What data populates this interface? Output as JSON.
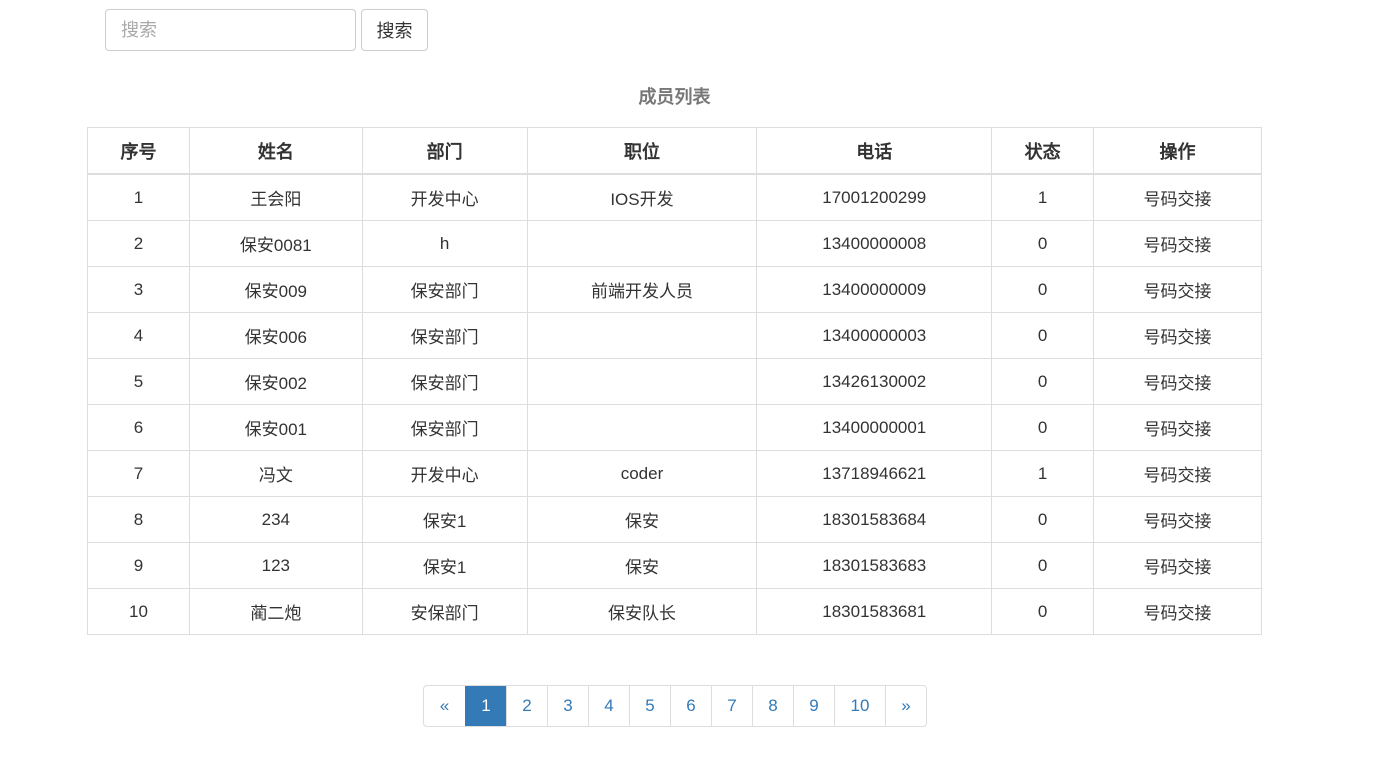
{
  "search": {
    "placeholder": "搜索",
    "value": "",
    "button_label": "搜索"
  },
  "table": {
    "caption": "成员列表",
    "headers": [
      "序号",
      "姓名",
      "部门",
      "职位",
      "电话",
      "状态",
      "操作"
    ],
    "rows": [
      {
        "index": "1",
        "name": "王会阳",
        "dept": "开发中心",
        "position": "IOS开发",
        "phone": "17001200299",
        "status": "1",
        "action": "号码交接"
      },
      {
        "index": "2",
        "name": "保安0081",
        "dept": "h",
        "position": "",
        "phone": "13400000008",
        "status": "0",
        "action": "号码交接"
      },
      {
        "index": "3",
        "name": "保安009",
        "dept": "保安部门",
        "position": "前端开发人员",
        "phone": "13400000009",
        "status": "0",
        "action": "号码交接"
      },
      {
        "index": "4",
        "name": "保安006",
        "dept": "保安部门",
        "position": "",
        "phone": "13400000003",
        "status": "0",
        "action": "号码交接"
      },
      {
        "index": "5",
        "name": "保安002",
        "dept": "保安部门",
        "position": "",
        "phone": "13426130002",
        "status": "0",
        "action": "号码交接"
      },
      {
        "index": "6",
        "name": "保安001",
        "dept": "保安部门",
        "position": "",
        "phone": "13400000001",
        "status": "0",
        "action": "号码交接"
      },
      {
        "index": "7",
        "name": "冯文",
        "dept": "开发中心",
        "position": "coder",
        "phone": "13718946621",
        "status": "1",
        "action": "号码交接"
      },
      {
        "index": "8",
        "name": "234",
        "dept": "保安1",
        "position": "保安",
        "phone": "18301583684",
        "status": "0",
        "action": "号码交接"
      },
      {
        "index": "9",
        "name": "123",
        "dept": "保安1",
        "position": "保安",
        "phone": "18301583683",
        "status": "0",
        "action": "号码交接"
      },
      {
        "index": "10",
        "name": "蔺二炮",
        "dept": "安保部门",
        "position": "保安队长",
        "phone": "18301583681",
        "status": "0",
        "action": "号码交接"
      }
    ]
  },
  "pagination": {
    "prev": "«",
    "next": "»",
    "pages": [
      "1",
      "2",
      "3",
      "4",
      "5",
      "6",
      "7",
      "8",
      "9",
      "10"
    ],
    "current": "1"
  },
  "colors": {
    "accent": "#337ab7",
    "border": "#dddddd",
    "caption": "#777777"
  }
}
